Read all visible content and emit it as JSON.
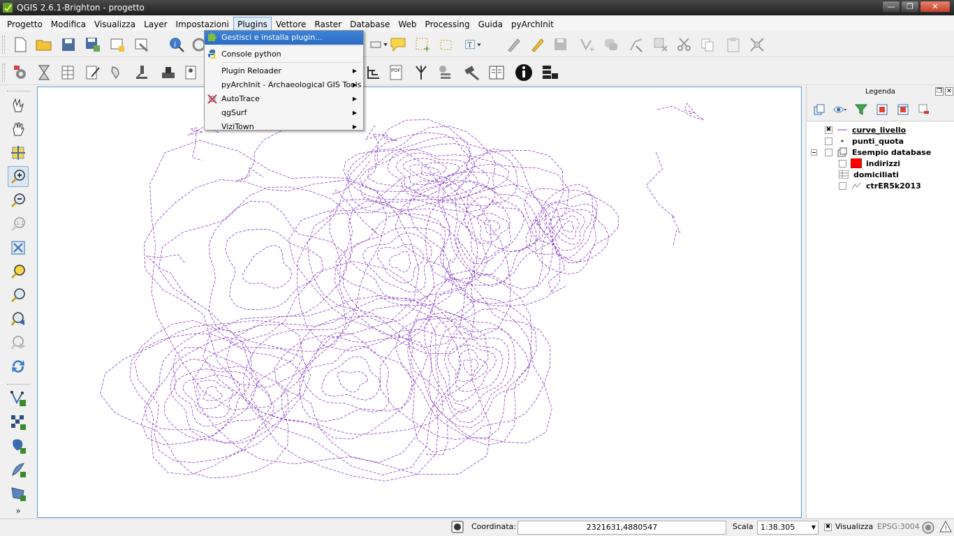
{
  "window": {
    "title": "QGIS 2.6.1-Brighton - progetto",
    "min": "—",
    "max": "❐",
    "close": "✕"
  },
  "menubar": [
    "Progetto",
    "Modifica",
    "Visualizza",
    "Layer",
    "Impostazioni",
    "Plugins",
    "Vettore",
    "Raster",
    "Database",
    "Web",
    "Processing",
    "Guida",
    "pyArchInit"
  ],
  "plugins_menu": {
    "items": [
      {
        "label": "Gestisci e installa plugin...",
        "highlighted": true,
        "submenu": false
      },
      {
        "label": "Console python",
        "highlighted": false,
        "submenu": false
      },
      {
        "label": "Plugin Reloader",
        "highlighted": false,
        "submenu": true
      },
      {
        "label": "pyArchInit - Archaeological GIS Tools",
        "highlighted": false,
        "submenu": true
      },
      {
        "label": "AutoTrace",
        "highlighted": false,
        "submenu": true
      },
      {
        "label": "qgSurf",
        "highlighted": false,
        "submenu": true
      },
      {
        "label": "ViziTown",
        "highlighted": false,
        "submenu": true
      }
    ],
    "arrow": "▶"
  },
  "legend": {
    "title": "Legenda",
    "float_btn": "❐",
    "close_btn": "✕",
    "layers": [
      {
        "name": "curve_livello",
        "checked": true,
        "check_mark": "✖",
        "symbol": "line",
        "underline": true
      },
      {
        "name": "punti_quota",
        "checked": false,
        "check_mark": "",
        "symbol": "point"
      },
      {
        "name": "Esempio database",
        "checked": false,
        "check_mark": "",
        "symbol": "group",
        "expander": "−"
      },
      {
        "name": "indirizzi",
        "checked": false,
        "check_mark": "",
        "symbol": "polygon-red"
      },
      {
        "name": "domiciliati",
        "checked": false,
        "check_mark": "",
        "symbol": "table"
      },
      {
        "name": "ctrER5k2013",
        "checked": false,
        "check_mark": "",
        "symbol": "raster"
      }
    ],
    "colors": {
      "polygon_fill": "#ff0000"
    }
  },
  "statusbar": {
    "coord_label": "Coordinata:",
    "coord_value": "2321631,4880547",
    "scale_label": "Scala",
    "scale_value": "1:38.305",
    "render_checked": "✖",
    "render_label": "Visualizza",
    "crs": "EPSG:3004"
  },
  "map": {
    "line_color": "#8a3fc6"
  }
}
